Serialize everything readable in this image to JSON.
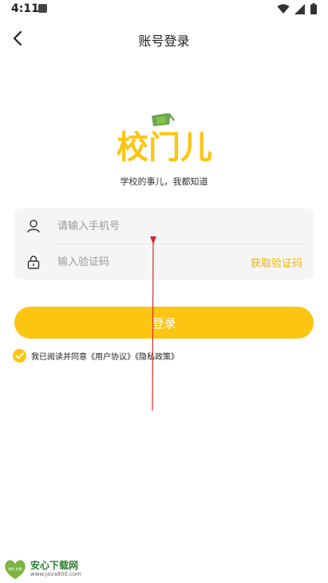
{
  "status_bar": {
    "time": "4:11"
  },
  "nav": {
    "title": "账号登录"
  },
  "logo": {
    "text": "校门儿"
  },
  "slogan": "学校的事儿，我都知道",
  "form": {
    "phone_placeholder": "请输入手机号",
    "code_placeholder": "输入验证码",
    "get_code_label": "获取验证码"
  },
  "login_button": "登录",
  "agreement": {
    "prefix": "我已阅读并同意",
    "user_agreement": "《用户协议》",
    "privacy_policy": "《隐私政策》",
    "checked": true
  },
  "watermark": {
    "title": "安心下载网",
    "url": "www.java800.com",
    "badge_text": "绿色 免费"
  },
  "colors": {
    "accent": "#fcc512",
    "link": "#f1b400",
    "logo_green": "#6aa84f",
    "arrow": "#d62b2b"
  }
}
